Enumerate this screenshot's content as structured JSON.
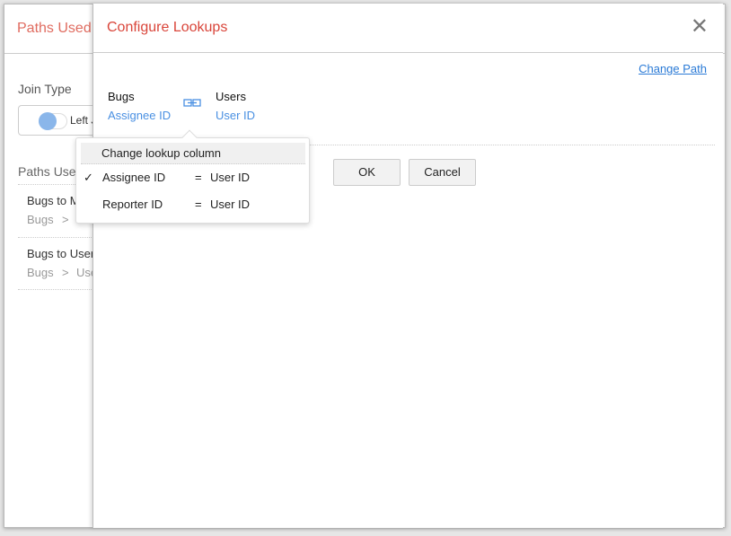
{
  "background_panel": {
    "title": "Paths Used",
    "join_type_label": "Join Type",
    "toggle_label": "Left J",
    "paths_used_label": "Paths Used",
    "paths": [
      {
        "name": "Bugs to M",
        "from": "Bugs",
        "sep": ">",
        "to": ""
      },
      {
        "name": "Bugs to User",
        "from": "Bugs",
        "sep": ">",
        "to": "Use"
      }
    ]
  },
  "modal": {
    "title": "Configure Lookups",
    "close": "✕",
    "change_path": "Change Path",
    "left_table": "Bugs",
    "left_column": "Assignee ID",
    "right_table": "Users",
    "right_column": "User ID",
    "ok": "OK",
    "cancel": "Cancel"
  },
  "dropdown": {
    "header": "Change lookup column",
    "checkmark": "✓",
    "options": [
      {
        "left": "Assignee ID",
        "eq": "=",
        "right": "User ID",
        "selected": true
      },
      {
        "left": "Reporter ID",
        "eq": "=",
        "right": "User ID",
        "selected": false
      }
    ]
  },
  "colors": {
    "title_red": "#d9453a",
    "link_blue": "#4a90e2"
  }
}
